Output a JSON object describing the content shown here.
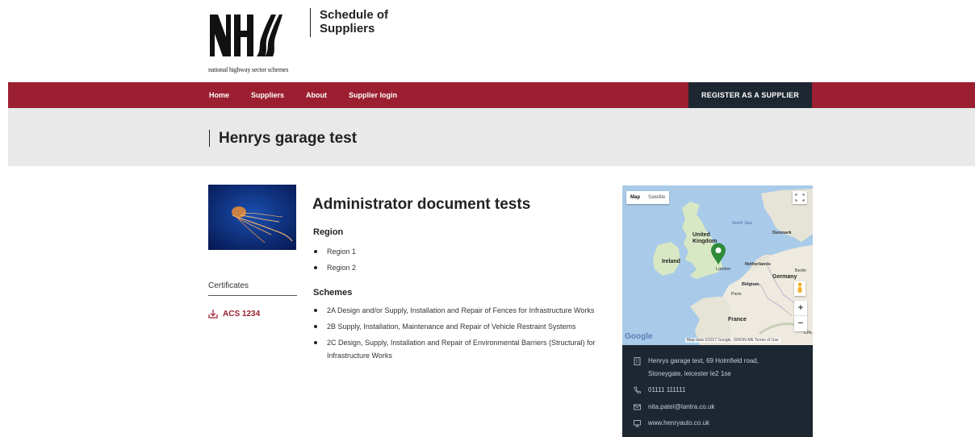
{
  "header": {
    "logo_text": "NHSS",
    "logo_subtitle": "national highway sector schemes",
    "site_title": "Schedule of Suppliers"
  },
  "nav": {
    "items": [
      {
        "label": "Home"
      },
      {
        "label": "Suppliers"
      },
      {
        "label": "About"
      },
      {
        "label": "Supplier login"
      }
    ],
    "register_label": "REGISTER AS A SUPPLIER"
  },
  "page": {
    "title": "Henrys garage test"
  },
  "sidebar": {
    "certificates_heading": "Certificates",
    "certificates": [
      {
        "label": "ACS 1234",
        "icon": "download-icon"
      }
    ]
  },
  "document": {
    "title": "Administrator document tests",
    "region_heading": "Region",
    "regions": [
      "Region 1",
      "Region 2"
    ],
    "schemes_heading": "Schemes",
    "schemes": [
      "2A Design and/or Supply, Installation and Repair of Fences for Infrastructure Works",
      "2B Supply, Installation, Maintenance and Repair of Vehicle Restraint Systems",
      "2C Design, Supply, Installation and Repair of Environmental Barriers (Structural) for Infrastructure Works"
    ]
  },
  "map": {
    "type_active": "Map",
    "type_inactive": "Satellite",
    "labels": {
      "north_sea": "North Sea",
      "united_kingdom": "United\nKingdom",
      "ireland": "Ireland",
      "denmark": "Denmark",
      "netherlands": "Netherlands",
      "london": "London",
      "berlin": "Berlin",
      "germany": "Germany",
      "belgium": "Belgium",
      "paris": "Paris",
      "france": "France",
      "cro": "Cro"
    },
    "google_label": "Google",
    "attribution": "Map data ©2017 Google, ORION-ME   Terms of Use",
    "zoom_in": "+",
    "zoom_out": "−",
    "colors": {
      "water": "#a9cbe9",
      "land": "#f2efe6",
      "marker": "#2e8b3a"
    }
  },
  "contact": {
    "address": "Henrys garage test, 69 Holmfield road, Stoneygate, leicester le2 1se",
    "phone": "01111 111111",
    "email": "nita.pateI@lantra.co.uk",
    "website": "www.henryauto.co.uk"
  },
  "colors": {
    "brand": "#9b1f30",
    "dark": "#1d2731",
    "title_bar": "#e9e9e9"
  }
}
